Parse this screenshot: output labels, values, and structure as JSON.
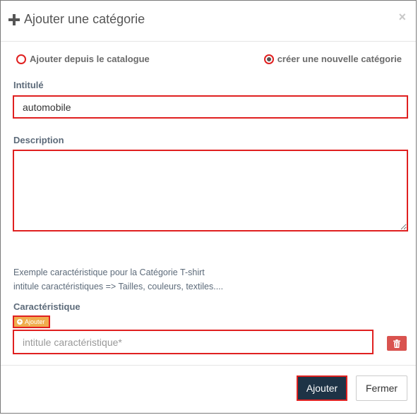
{
  "modal": {
    "title": "Ajouter une catégorie",
    "close_symbol": "×"
  },
  "options": {
    "from_catalog_label": "Ajouter depuis le catalogue",
    "new_category_label": "créer une nouvelle catégorie",
    "selected": "new_category"
  },
  "form": {
    "title_label": "Intitulé",
    "title_value": "automobile",
    "description_label": "Description",
    "description_value": "",
    "hint_line1": "Exemple caractéristique pour la Catégorie T-shirt",
    "hint_line2": "intitule caractéristiques => Tailles, couleurs, textiles....",
    "characteristic_label": "Caractéristique",
    "add_characteristic_label": "Ajouter",
    "characteristic_placeholder": "intitule caractéristique*"
  },
  "footer": {
    "submit_label": "Ajouter",
    "close_label": "Fermer"
  },
  "colors": {
    "accent_border": "#e02020",
    "primary_button": "#1e3346",
    "warning_button": "#f0ad4e",
    "danger_button": "#d9534f"
  }
}
